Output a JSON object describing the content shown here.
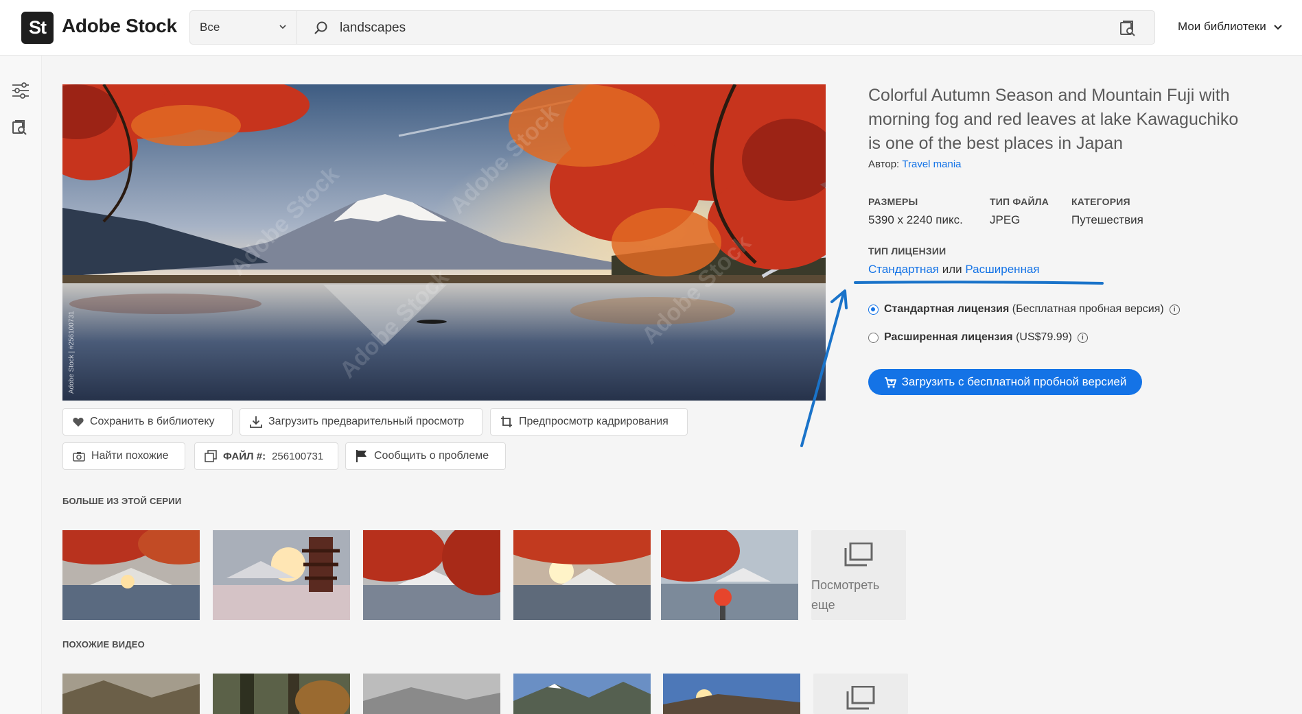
{
  "brand": {
    "badge": "St",
    "name": "Adobe Stock"
  },
  "search": {
    "scope": "Все",
    "query": "landscapes"
  },
  "header": {
    "libraries_label": "Мои библиотеки"
  },
  "image": {
    "file_id_vertical": "Adobe Stock | #256100731",
    "watermark": "Adobe Stock"
  },
  "actions": {
    "save_library": "Сохранить в библиотеку",
    "download_preview": "Загрузить предварительный просмотр",
    "crop_preview": "Предпросмотр кадрирования",
    "find_similar": "Найти похожие",
    "file_label": "ФАЙЛ #:",
    "file_number": "256100731",
    "report": "Сообщить о проблеме"
  },
  "details": {
    "title": "Colorful Autumn Season and Mountain Fuji with morning fog and red leaves at lake Kawaguchiko is one of the best places in Japan",
    "author_label": "Автор:",
    "author_name": "Travel mania",
    "size_label": "РАЗМЕРЫ",
    "size_value": "5390 x 2240 пикс.",
    "filetype_label": "ТИП ФАЙЛА",
    "filetype_value": "JPEG",
    "category_label": "КАТЕГОРИЯ",
    "category_value": "Путешествия",
    "license_type_label": "ТИП ЛИЦЕНЗИИ",
    "license_standard": "Стандартная",
    "license_or": "или",
    "license_extended": "Расширенная"
  },
  "licenses": [
    {
      "name": "Стандартная лицензия",
      "note": "(Бесплатная пробная версия)",
      "selected": true
    },
    {
      "name": "Расширенная лицензия",
      "note": "(US$79.99)",
      "selected": false
    }
  ],
  "cta": {
    "label": "Загрузить с бесплатной пробной версией"
  },
  "series": {
    "label": "БОЛЬШЕ ИЗ ЭТОЙ СЕРИИ",
    "more_label": "Посмотреть еще"
  },
  "videos": {
    "label": "ПОХОЖИЕ ВИДЕО"
  },
  "colors": {
    "accent": "#1473e6",
    "annotation": "#1a73c9",
    "header_bg": "#ffffff",
    "page_bg": "#f5f5f5"
  }
}
